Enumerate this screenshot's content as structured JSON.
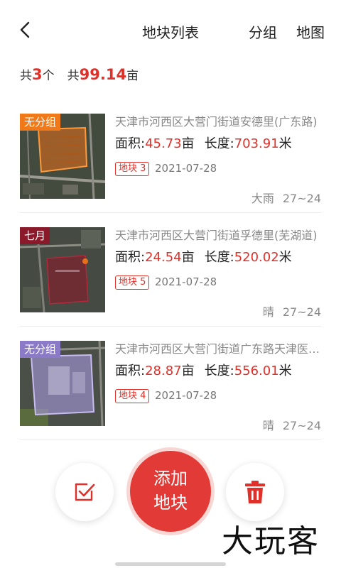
{
  "header": {
    "title": "地块列表",
    "group_label": "分组",
    "map_label": "地图"
  },
  "summary": {
    "prefix_count": "共",
    "count": "3",
    "count_unit": "个",
    "prefix_area": "共",
    "total_area": "99.14",
    "area_unit": "亩"
  },
  "labels": {
    "area": "面积:",
    "area_unit": "亩",
    "length": "长度:",
    "length_unit": "米"
  },
  "plots": [
    {
      "group": "无分组",
      "group_color": "#f07a1a",
      "address": "天津市河西区大营门街道安德里(广东路)",
      "area": "45.73",
      "length": "703.91",
      "badge": "地块 3",
      "date": "2021-07-28",
      "weather": "大雨",
      "temp": "27~24",
      "overlay_color": "#e8701a"
    },
    {
      "group": "七月",
      "group_color": "#8a1a2a",
      "address": "天津市河西区大营门街道孚德里(芜湖道)",
      "area": "24.54",
      "length": "520.02",
      "badge": "地块 5",
      "date": "2021-07-28",
      "weather": "晴",
      "temp": "27~24",
      "overlay_color": "#8a1a2a"
    },
    {
      "group": "无分组",
      "group_color": "#8a7ac8",
      "address": "天津市河西区大营门街道广东路天津医科大学",
      "area": "28.87",
      "length": "556.01",
      "badge": "地块 4",
      "date": "2021-07-28",
      "weather": "晴",
      "temp": "27~24",
      "overlay_color": "#a99ae0"
    }
  ],
  "actions": {
    "add_line1": "添加",
    "add_line2": "地块"
  },
  "watermark": "大玩客",
  "icons": {
    "back": "chevron-left-icon",
    "select": "checkbox-icon",
    "delete": "trash-icon"
  }
}
